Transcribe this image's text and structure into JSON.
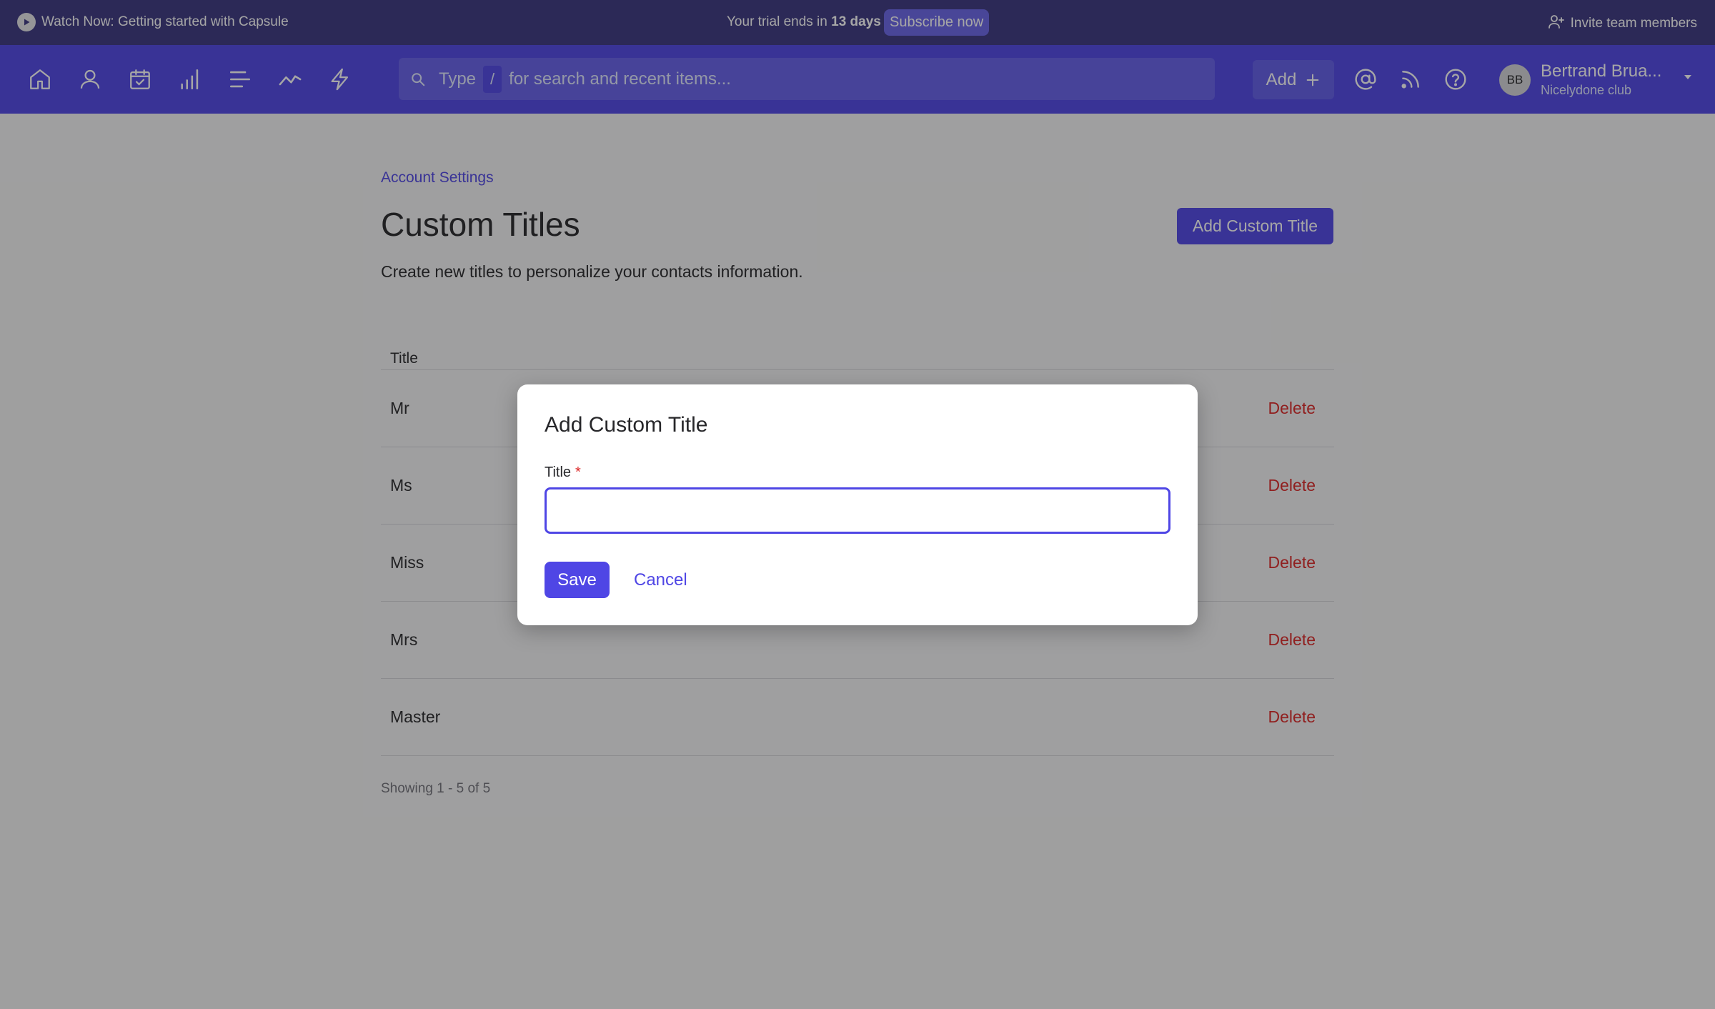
{
  "announce": {
    "watch_label": "Watch Now: Getting started with Capsule",
    "trial_prefix": "Your trial ends in",
    "trial_days": "13 days",
    "subscribe_label": "Subscribe now",
    "invite_label": "Invite team members"
  },
  "nav": {
    "icons": [
      "home-icon",
      "person-icon",
      "calendar-check-icon",
      "bar-chart-icon",
      "list-icon",
      "trend-line-icon",
      "lightning-icon"
    ],
    "search": {
      "prefix": "Type",
      "key": "/",
      "suffix": "for search and recent items..."
    },
    "add_label": "Add",
    "right_icons": [
      "at-sign-icon",
      "feed-icon",
      "help-icon"
    ],
    "user": {
      "initials": "BB",
      "name": "Bertrand Brua...",
      "org": "Nicelydone club"
    }
  },
  "page": {
    "breadcrumb": "Account Settings",
    "title": "Custom Titles",
    "add_button": "Add Custom Title",
    "subtitle": "Create new titles to personalize your contacts information.",
    "table": {
      "header": "Title",
      "rows": [
        {
          "title": "Mr",
          "action": "Delete"
        },
        {
          "title": "Ms",
          "action": "Delete"
        },
        {
          "title": "Miss",
          "action": "Delete"
        },
        {
          "title": "Mrs",
          "action": "Delete"
        },
        {
          "title": "Master",
          "action": "Delete"
        }
      ]
    },
    "showing": "Showing 1 - 5 of 5"
  },
  "modal": {
    "title": "Add Custom Title",
    "field_label": "Title",
    "required_mark": "*",
    "field_value": "",
    "save_label": "Save",
    "cancel_label": "Cancel"
  },
  "colors": {
    "brand": "#4f46e5",
    "announce_bar": "#3b3680",
    "danger": "#dc2626"
  }
}
